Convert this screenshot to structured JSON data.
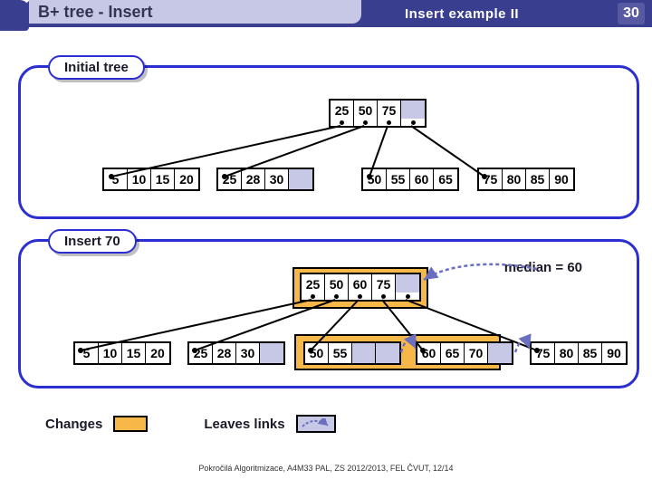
{
  "header": {
    "title": "B+ tree - Insert",
    "subtitle": "Insert example II",
    "page_number": "30"
  },
  "panel1": {
    "label": "Initial tree",
    "root": [
      "25",
      "50",
      "75",
      ""
    ],
    "leaves": [
      [
        "5",
        "10",
        "15",
        "20"
      ],
      [
        "25",
        "28",
        "30",
        ""
      ],
      [
        "50",
        "55",
        "60",
        "65"
      ],
      [
        "75",
        "80",
        "85",
        "90"
      ]
    ]
  },
  "panel2": {
    "label": "Insert 70",
    "annotation": "median = 60",
    "root": [
      "25",
      "50",
      "60",
      "75",
      ""
    ],
    "leaves": [
      [
        "5",
        "10",
        "15",
        "20"
      ],
      [
        "25",
        "28",
        "30",
        ""
      ],
      [
        "50",
        "55",
        "",
        ""
      ],
      [
        "60",
        "65",
        "70",
        ""
      ],
      [
        "75",
        "80",
        "85",
        "90"
      ]
    ]
  },
  "legend": {
    "changes": "Changes",
    "leaves_links": "Leaves links"
  },
  "footer": "Pokročilá Algoritmizace, A4M33 PAL, ZS 2012/2013, FEL ČVUT, 12/14"
}
